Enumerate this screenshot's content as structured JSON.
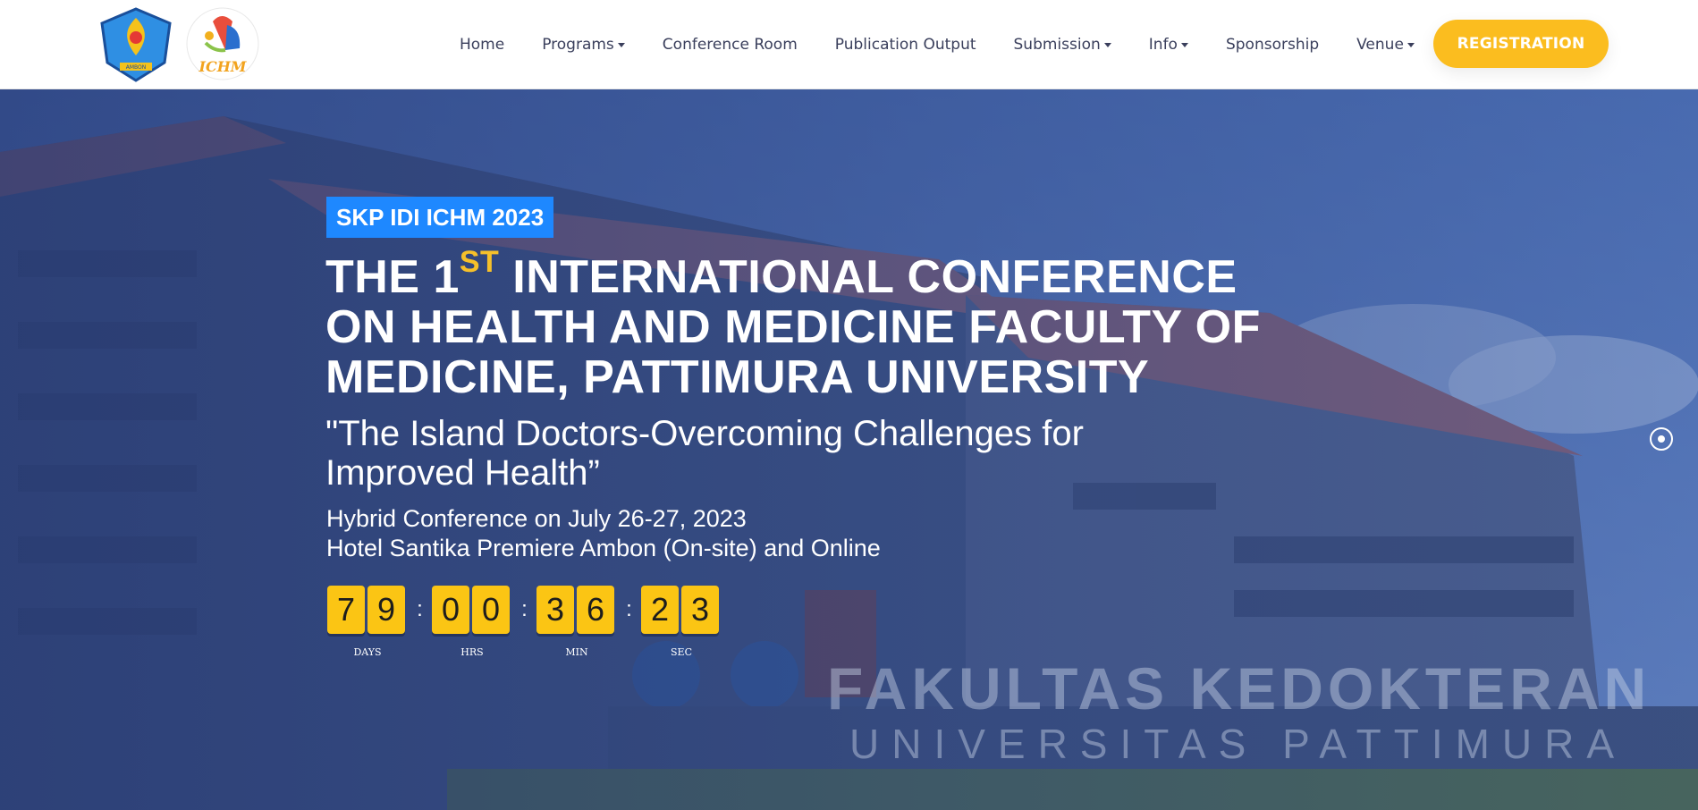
{
  "nav": {
    "home": "Home",
    "programs": "Programs",
    "conference_room": "Conference Room",
    "publication_output": "Publication Output",
    "submission": "Submission",
    "info": "Info",
    "sponsorship": "Sponsorship",
    "venue": "Venue",
    "registration": "REGISTRATION"
  },
  "logos": {
    "university": "UNIVERSITAS PATTIMURA",
    "university_city": "AMBON",
    "ichm": "ICHM"
  },
  "hero": {
    "tag": "SKP IDI ICHM 2023",
    "title_start": "THE 1",
    "title_sup": "ST",
    "title_rest": " INTERNATIONAL CONFERENCE ON HEALTH AND MEDICINE FACULTY OF MEDICINE, PATTIMURA UNIVERSITY",
    "quote": "\"The Island Doctors-Overcoming Challenges for Improved Health”",
    "info_line1": "Hybrid Conference on July 26-27, 2023",
    "info_line2": "Hotel Santika Premiere Ambon (On-site) and Online",
    "sign_line1": "FAKULTAS KEDOKTERAN",
    "sign_line2": "UNIVERSITAS PATTIMURA"
  },
  "countdown": {
    "days": [
      "7",
      "9"
    ],
    "hrs": [
      "0",
      "0"
    ],
    "min": [
      "3",
      "6"
    ],
    "sec": [
      "2",
      "3"
    ],
    "label_days": "DAYS",
    "label_hrs": "HRS",
    "label_min": "MIN",
    "label_sec": "SEC",
    "separator": ":"
  },
  "colors": {
    "accent": "#fbbd1f",
    "tag_blue": "#1e88ff",
    "nav_text": "#3a3f5c"
  }
}
